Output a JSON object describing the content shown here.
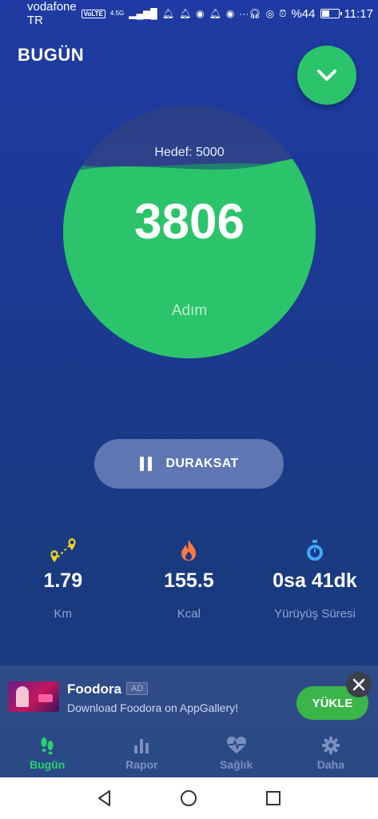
{
  "status_bar": {
    "carrier": "vodafone TR",
    "volte": "VoLTE",
    "network": "4.5G",
    "battery_text": "%44",
    "time": "11:17"
  },
  "header": {
    "title": "BUGÜN",
    "fab_icon": "chevron-down-icon"
  },
  "progress": {
    "goal_label": "Hedef: 5000",
    "steps": "3806",
    "unit": "Adım",
    "fill_fraction": 0.76,
    "fill_color": "#2bc46a"
  },
  "pause_button": {
    "label": "DURAKSAT",
    "icon": "pause-icon"
  },
  "stats": [
    {
      "icon": "route-pin-icon",
      "value": "1.79",
      "label": "Km",
      "color": "#f2d21b"
    },
    {
      "icon": "flame-icon",
      "value": "155.5",
      "label": "Kcal",
      "color": "#ff7a3c"
    },
    {
      "icon": "stopwatch-icon",
      "value": "0sa 41dk",
      "label": "Yürüyüş Süresi",
      "color": "#3fa9f5"
    }
  ],
  "ad": {
    "title": "Foodora",
    "badge": "AD",
    "description": "Download Foodora on AppGallery!",
    "install_label": "YÜKLE"
  },
  "bottom_nav": [
    {
      "label": "Bugün",
      "icon": "footsteps-icon",
      "active": true
    },
    {
      "label": "Rapor",
      "icon": "bar-chart-icon",
      "active": false
    },
    {
      "label": "Sağlık",
      "icon": "heart-pulse-icon",
      "active": false
    },
    {
      "label": "Daha",
      "icon": "gear-icon",
      "active": false
    }
  ],
  "colors": {
    "accent": "#2bc46a",
    "background": "#1b3a8f"
  }
}
